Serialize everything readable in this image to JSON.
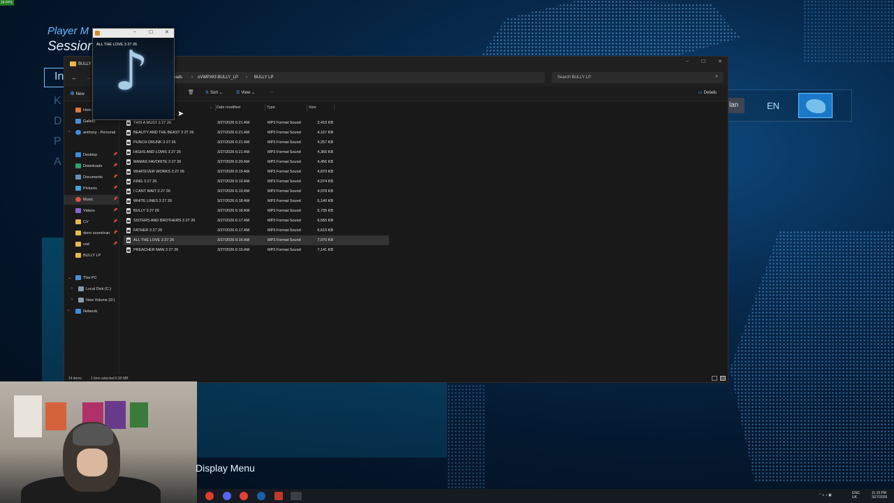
{
  "game": {
    "fps": "29 FPS",
    "player_menu": "Player M",
    "session": "Session",
    "in_button": "In",
    "side_letters": [
      "K",
      "D",
      "P",
      "A"
    ],
    "lang_small": "lan",
    "lang_en": "EN",
    "display_menu": "Display Menu"
  },
  "explorer": {
    "title": "BULLY L",
    "window_controls": {
      "minimize": "–",
      "maximize": "☐",
      "close": "✕"
    },
    "breadcrumbs": [
      "oads",
      "oVWPXKf-BULLY_LP",
      "BULLY LP"
    ],
    "search_placeholder": "Search BULLY LP",
    "toolbar": {
      "new": "New",
      "sort": "Sort",
      "view": "View",
      "more": "···",
      "details": "Details"
    },
    "sidebar": [
      {
        "label": "Hom",
        "icon": "home-icon"
      },
      {
        "label": "Gallery",
        "icon": "gallery-icon"
      },
      {
        "label": "anthony - Personal",
        "icon": "cloud-icon"
      },
      {
        "label": "Desktop",
        "icon": "desktop-icon"
      },
      {
        "label": "Downloads",
        "icon": "download-icon"
      },
      {
        "label": "Documents",
        "icon": "documents-icon"
      },
      {
        "label": "Pictures",
        "icon": "pictures-icon"
      },
      {
        "label": "Music",
        "icon": "music-icon"
      },
      {
        "label": "Videos",
        "icon": "videos-icon"
      },
      {
        "label": "CV",
        "icon": "folder-icon"
      },
      {
        "label": "dono sound+an",
        "icon": "folder-icon"
      },
      {
        "label": "vod",
        "icon": "folder-icon"
      },
      {
        "label": "BULLY LP",
        "icon": "folder-icon"
      },
      {
        "label": "This PC",
        "icon": "pc-icon"
      },
      {
        "label": "Local Disk (C:)",
        "icon": "drive-icon"
      },
      {
        "label": "New Volume (D:)",
        "icon": "drive-icon"
      },
      {
        "label": "Network",
        "icon": "network-icon"
      }
    ],
    "columns": {
      "name": "",
      "date": "Date modified",
      "type": "Type",
      "size": "Size"
    },
    "files": [
      {
        "name": "THIS A MUST 3 27 26",
        "date": "3/27/2026 6:21 AM",
        "type": "MP3 Format Sound",
        "size": "3,410 KB"
      },
      {
        "name": "BEAUTY AND THE BEAST 3 27 26",
        "date": "3/27/2026 6:21 AM",
        "type": "MP3 Format Sound",
        "size": "4,167 KB"
      },
      {
        "name": "PUNCH DRUNK 3 27 26",
        "date": "3/27/2026 6:21 AM",
        "type": "MP3 Format Sound",
        "size": "4,257 KB"
      },
      {
        "name": "HIGHS AND LOWS 3 27 26",
        "date": "3/27/2026 6:21 AM",
        "type": "MP3 Format Sound",
        "size": "4,365 KB"
      },
      {
        "name": "MAMAS FAVORITE 3 27 26",
        "date": "3/27/2026 6:20 AM",
        "type": "MP3 Format Sound",
        "size": "4,456 KB"
      },
      {
        "name": "WHATEVER WORKS 3 27 26",
        "date": "3/27/2026 6:19 AM",
        "type": "MP3 Format Sound",
        "size": "4,870 KB"
      },
      {
        "name": "KING 3 27 26",
        "date": "3/27/2026 6:19 AM",
        "type": "MP3 Format Sound",
        "size": "4,974 KB"
      },
      {
        "name": "I CANT WAIT 3 27 26",
        "date": "3/27/2026 6:19 AM",
        "type": "MP3 Format Sound",
        "size": "4,978 KB"
      },
      {
        "name": "WHITE LINES 3 27 26",
        "date": "3/27/2026 6:18 AM",
        "type": "MP3 Format Sound",
        "size": "5,140 KB"
      },
      {
        "name": "BULLY 3 27 26",
        "date": "3/27/2026 6:18 AM",
        "type": "MP3 Format Sound",
        "size": "5,735 KB"
      },
      {
        "name": "SISTERS AND BROTHERS 3 27 26",
        "date": "3/27/2026 6:17 AM",
        "type": "MP3 Format Sound",
        "size": "6,565 KB"
      },
      {
        "name": "FATHER 3 27 26",
        "date": "3/27/2026 6:17 AM",
        "type": "MP3 Format Sound",
        "size": "6,619 KB"
      },
      {
        "name": "ALL THE LOVE 3 27 26",
        "date": "3/27/2026 6:16 AM",
        "type": "MP3 Format Sound",
        "size": "7,070 KB"
      },
      {
        "name": "PREACHER MAN 3 27 26",
        "date": "3/27/2026 6:15 AM",
        "type": "MP3 Format Sound",
        "size": "7,141 KB"
      }
    ],
    "selected_index": 12,
    "status": {
      "count": "14 items",
      "selection": "1 item selected  6.90 MB"
    }
  },
  "player": {
    "window_controls": {
      "minimize": "–",
      "maximize": "☐",
      "close": "✕"
    },
    "track": "ALL THE LOVE 3 27 26"
  },
  "taskbar": {
    "lang": "ENG",
    "region": "UK",
    "time": "11:19 PM",
    "date": "3/27/2026"
  }
}
